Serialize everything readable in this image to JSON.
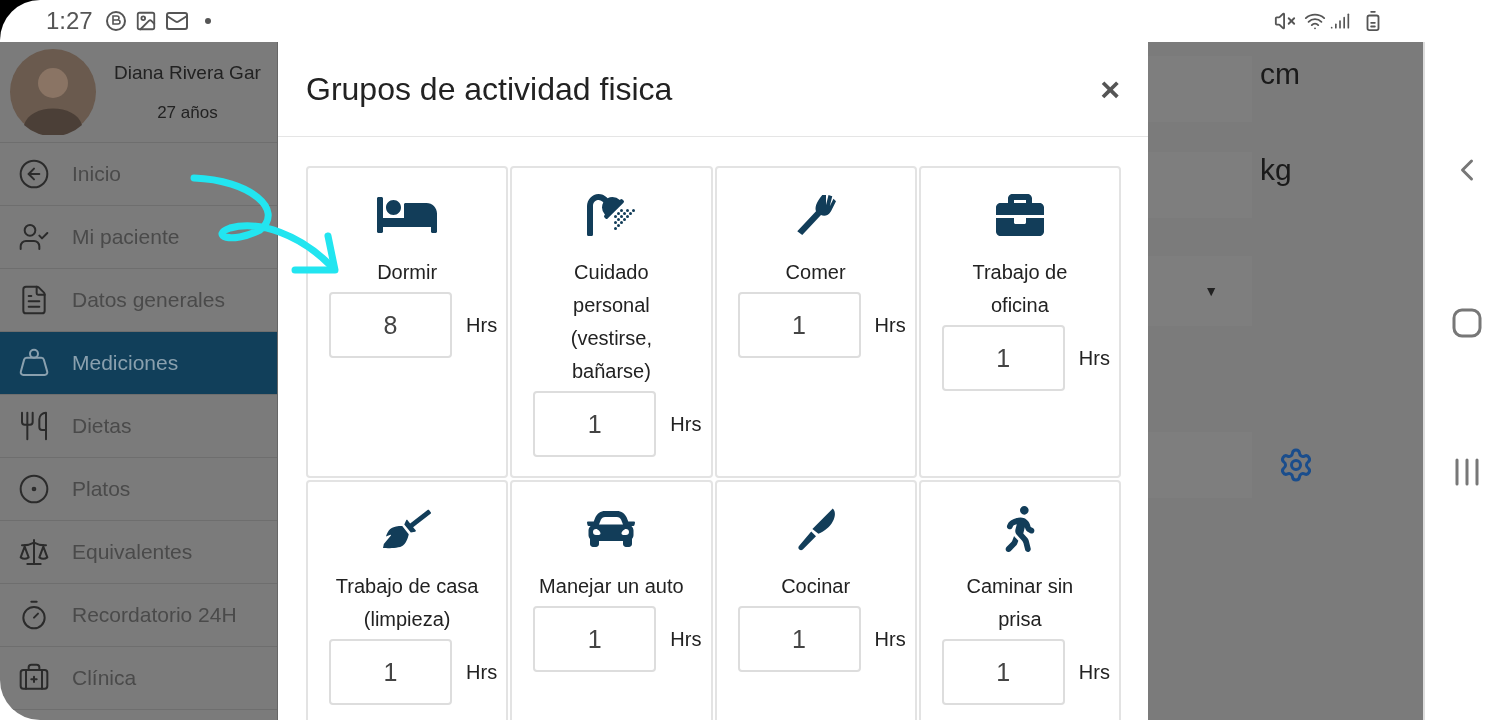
{
  "status_bar": {
    "time": "1:27"
  },
  "sidebar": {
    "name": "Diana Rivera Gar",
    "age": "27 años",
    "items": [
      {
        "label": "Inicio",
        "selected": false
      },
      {
        "label": "Mi paciente",
        "selected": false
      },
      {
        "label": "Datos generales",
        "selected": false
      },
      {
        "label": "Mediciones",
        "selected": true
      },
      {
        "label": "Dietas",
        "selected": false
      },
      {
        "label": "Platos",
        "selected": false
      },
      {
        "label": "Equivalentes",
        "selected": false
      },
      {
        "label": "Recordatorio 24H",
        "selected": false
      },
      {
        "label": "Clínica",
        "selected": false
      }
    ]
  },
  "background_form": {
    "units": [
      "cm",
      "kg"
    ],
    "dropdown_caret": "▼"
  },
  "modal": {
    "title": "Grupos de actividad fisica",
    "close": "×",
    "activities": [
      {
        "label": "Dormir",
        "value": "8",
        "unit": "Hrs"
      },
      {
        "label": "Cuidado personal (vestirse, bañarse)",
        "value": "1",
        "unit": "Hrs"
      },
      {
        "label": "Comer",
        "value": "1",
        "unit": "Hrs"
      },
      {
        "label": "Trabajo de oficina",
        "value": "1",
        "unit": "Hrs"
      },
      {
        "label": "Trabajo de casa (limpieza)",
        "value": "1",
        "unit": "Hrs"
      },
      {
        "label": "Manejar un auto",
        "value": "1",
        "unit": "Hrs"
      },
      {
        "label": "Cocinar",
        "value": "1",
        "unit": "Hrs"
      },
      {
        "label": "Caminar sin prisa",
        "value": "1",
        "unit": "Hrs"
      }
    ]
  }
}
